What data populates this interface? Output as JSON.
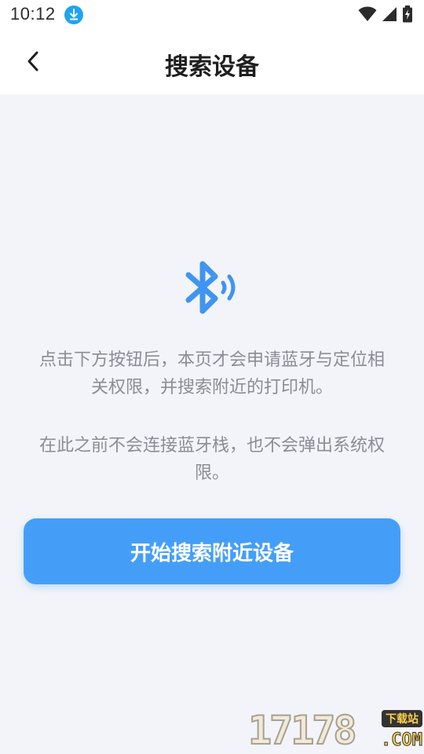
{
  "status_bar": {
    "time": "10:12",
    "icons": [
      "download-icon",
      "wifi-icon",
      "signal-icon",
      "battery-icon"
    ]
  },
  "header": {
    "back_icon": "chevron-left-icon",
    "title": "搜索设备"
  },
  "main": {
    "icon": "bluetooth-searching-icon",
    "description_1": "点击下方按钮后，本页才会申请蓝牙与定位相关权限，并搜索附近的打印机。",
    "description_2": "在此之前不会连接蓝牙栈，也不会弹出系统权限。",
    "button_label": "开始搜索附近设备"
  },
  "watermark": {
    "number": "17178",
    "tag": "下载站",
    "domain": ".COM"
  },
  "colors": {
    "accent": "#449ef8",
    "background": "#f3f4f9",
    "muted_text": "#8a8d96"
  }
}
